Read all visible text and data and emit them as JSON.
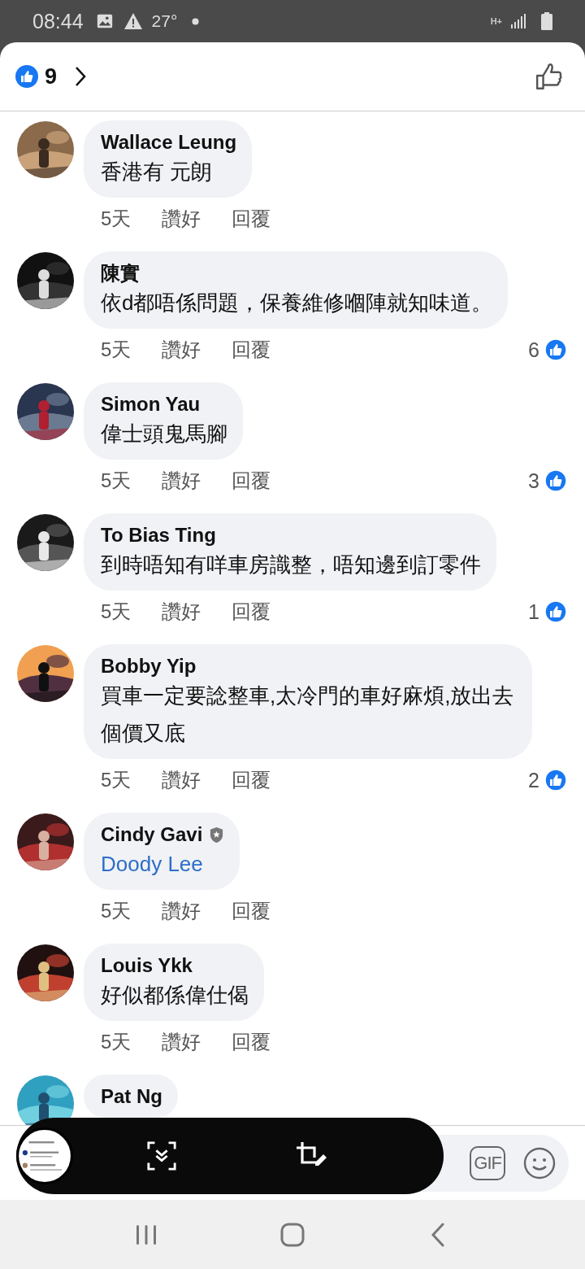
{
  "status_bar": {
    "time": "08:44",
    "temperature": "27°",
    "network": "H+"
  },
  "header": {
    "reaction_count": "9"
  },
  "comments": [
    {
      "author": "Wallace Leung",
      "badge": false,
      "text": "香港有 元朗",
      "mention": false,
      "age": "5天",
      "like": "讚好",
      "reply": "回覆"
    },
    {
      "author": "陳實",
      "badge": false,
      "text": "依d都唔係問題，保養維修嗰陣就知味道。",
      "mention": false,
      "age": "5天",
      "like": "讚好",
      "reply": "回覆",
      "likes": "6"
    },
    {
      "author": "Simon Yau",
      "badge": false,
      "text": "偉士頭鬼馬腳",
      "mention": false,
      "age": "5天",
      "like": "讚好",
      "reply": "回覆",
      "likes": "3"
    },
    {
      "author": "To Bias Ting",
      "badge": false,
      "text": "到時唔知有咩車房識整，唔知邊到訂零件",
      "mention": false,
      "age": "5天",
      "like": "讚好",
      "reply": "回覆",
      "likes": "1"
    },
    {
      "author": "Bobby Yip",
      "badge": false,
      "text": "買車一定要諗整車,太冷門的車好麻煩,放出去個價又底",
      "mention": false,
      "age": "5天",
      "like": "讚好",
      "reply": "回覆",
      "likes": "2"
    },
    {
      "author": "Cindy Gavi",
      "badge": true,
      "text": "Doody Lee",
      "mention": true,
      "age": "5天",
      "like": "讚好",
      "reply": "回覆"
    },
    {
      "author": "Louis Ykk",
      "badge": false,
      "text": "好似都係偉仕偈",
      "mention": false,
      "age": "5天",
      "like": "讚好",
      "reply": "回覆"
    },
    {
      "author": "Pat Ng",
      "badge": false
    }
  ],
  "composer": {
    "gif_label": "GIF"
  }
}
